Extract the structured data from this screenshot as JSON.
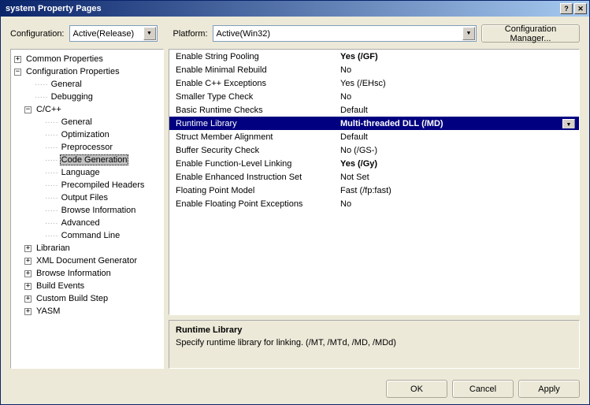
{
  "window": {
    "title": "system Property Pages"
  },
  "top": {
    "config_label": "Configuration:",
    "config_value": "Active(Release)",
    "platform_label": "Platform:",
    "platform_value": "Active(Win32)",
    "cfg_mgr_label": "Configuration Manager..."
  },
  "tree": {
    "common": "Common Properties",
    "configprops": "Configuration Properties",
    "general": "General",
    "debugging": "Debugging",
    "cpp": "C/C++",
    "cpp_general": "General",
    "cpp_optimization": "Optimization",
    "cpp_preprocessor": "Preprocessor",
    "cpp_codegen": "Code Generation",
    "cpp_language": "Language",
    "cpp_pch": "Precompiled Headers",
    "cpp_outputfiles": "Output Files",
    "cpp_browseinfo": "Browse Information",
    "cpp_advanced": "Advanced",
    "cpp_cmdline": "Command Line",
    "librarian": "Librarian",
    "xmldoc": "XML Document Generator",
    "browseinfo": "Browse Information",
    "buildevents": "Build Events",
    "custombuild": "Custom Build Step",
    "yasm": "YASM"
  },
  "props": [
    {
      "name": "Enable String Pooling",
      "value": "Yes (/GF)",
      "bold": true
    },
    {
      "name": "Enable Minimal Rebuild",
      "value": "No"
    },
    {
      "name": "Enable C++ Exceptions",
      "value": "Yes (/EHsc)"
    },
    {
      "name": "Smaller Type Check",
      "value": "No"
    },
    {
      "name": "Basic Runtime Checks",
      "value": "Default"
    },
    {
      "name": "Runtime Library",
      "value": "Multi-threaded DLL (/MD)",
      "selected": true
    },
    {
      "name": "Struct Member Alignment",
      "value": "Default"
    },
    {
      "name": "Buffer Security Check",
      "value": "No (/GS-)"
    },
    {
      "name": "Enable Function-Level Linking",
      "value": "Yes (/Gy)",
      "bold": true
    },
    {
      "name": "Enable Enhanced Instruction Set",
      "value": "Not Set"
    },
    {
      "name": "Floating Point Model",
      "value": "Fast (/fp:fast)"
    },
    {
      "name": "Enable Floating Point Exceptions",
      "value": "No"
    }
  ],
  "desc": {
    "title": "Runtime Library",
    "text": "Specify runtime library for linking.     (/MT, /MTd, /MD, /MDd)"
  },
  "buttons": {
    "ok": "OK",
    "cancel": "Cancel",
    "apply": "Apply"
  }
}
